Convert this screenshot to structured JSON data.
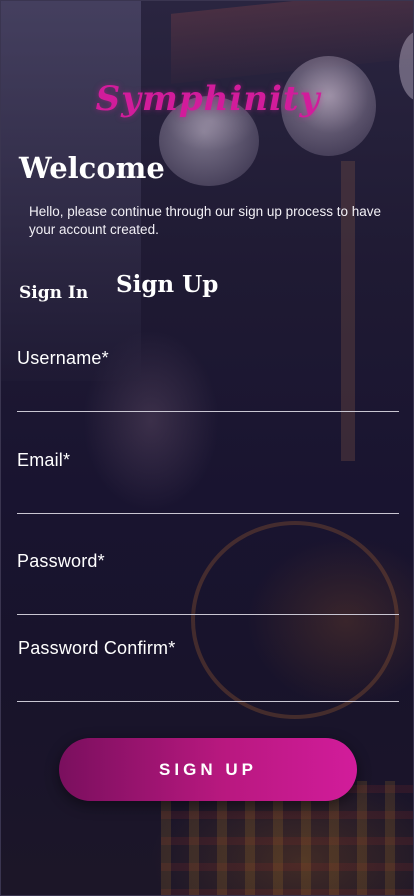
{
  "brand": {
    "logo_text": "Symphinity",
    "accent_color": "#d21c9b"
  },
  "welcome": {
    "title": "Welcome",
    "message": "Hello, please continue through our sign up process to have your account created."
  },
  "tabs": {
    "sign_in": "Sign In",
    "sign_up": "Sign Up",
    "active": "sign_up"
  },
  "form": {
    "fields": [
      {
        "label": "Username*",
        "value": ""
      },
      {
        "label": "Email*",
        "value": ""
      },
      {
        "label": "Password*",
        "value": ""
      },
      {
        "label": "Password Confirm*",
        "value": ""
      }
    ],
    "submit_label": "SIGN UP"
  }
}
